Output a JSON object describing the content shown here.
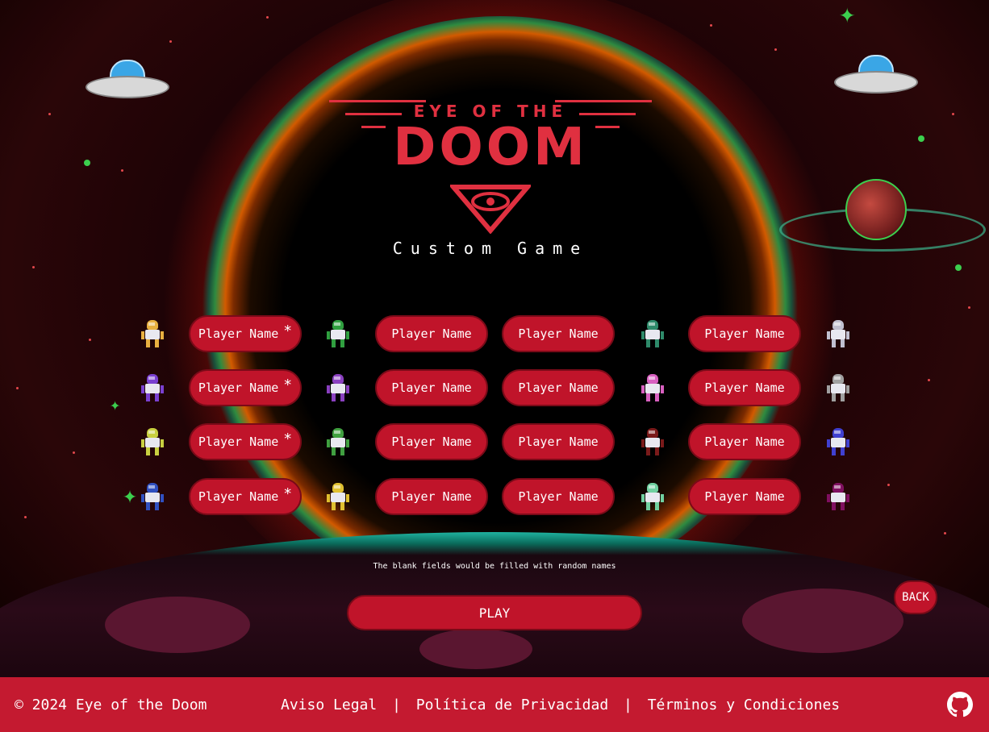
{
  "logo": {
    "top_text": "EYE OF THE",
    "main_text": "DOOM"
  },
  "subtitle": "Custom Game",
  "players": {
    "placeholder": "Player Name",
    "required_mark": "*",
    "rows": [
      {
        "sprites": [
          "#e8b040",
          "#30a040",
          "#2e8a6a",
          "#c0c0d0"
        ]
      },
      {
        "sprites": [
          "#7a40d0",
          "#8a40c0",
          "#d860c0",
          "#a0a0a0"
        ]
      },
      {
        "sprites": [
          "#c8d040",
          "#40a040",
          "#7a1a1a",
          "#4040d0"
        ]
      },
      {
        "sprites": [
          "#3050c0",
          "#e0c030",
          "#70d0a0",
          "#801060"
        ]
      }
    ]
  },
  "note": "The blank fields would be filled with random names",
  "play_label": "PLAY",
  "back_label": "BACK",
  "footer": {
    "copyright": "© 2024 Eye of the Doom",
    "legal": "Aviso Legal",
    "privacy": "Política de Privacidad",
    "terms": "Términos y Condiciones",
    "separator": "|"
  }
}
